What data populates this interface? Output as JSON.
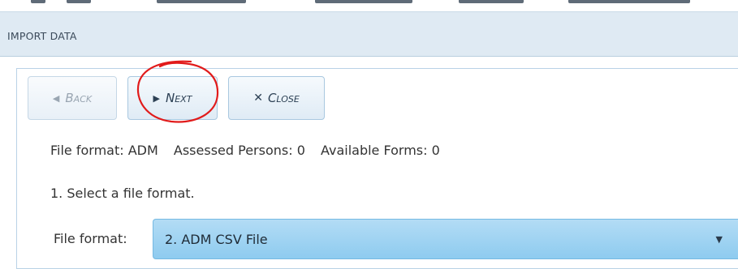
{
  "header": {
    "title": "IMPORT DATA"
  },
  "toolbar": {
    "back_label": "Back",
    "next_label": "Next",
    "close_label": "Close",
    "back_icon": "triangle-left-icon",
    "next_icon": "triangle-right-icon",
    "close_icon": "x-icon"
  },
  "status": {
    "file_format": "File format: ADM",
    "assessed_persons": "Assessed Persons: 0",
    "available_forms": "Available Forms: 0"
  },
  "instructions": {
    "step1": "1. Select a file format."
  },
  "file_format_field": {
    "label": "File format:",
    "selected": "2. ADM CSV File"
  },
  "colors": {
    "header_bg": "#dfeaf3",
    "select_bg": "#9fd3f3",
    "annotation_red": "#e11b1b"
  }
}
